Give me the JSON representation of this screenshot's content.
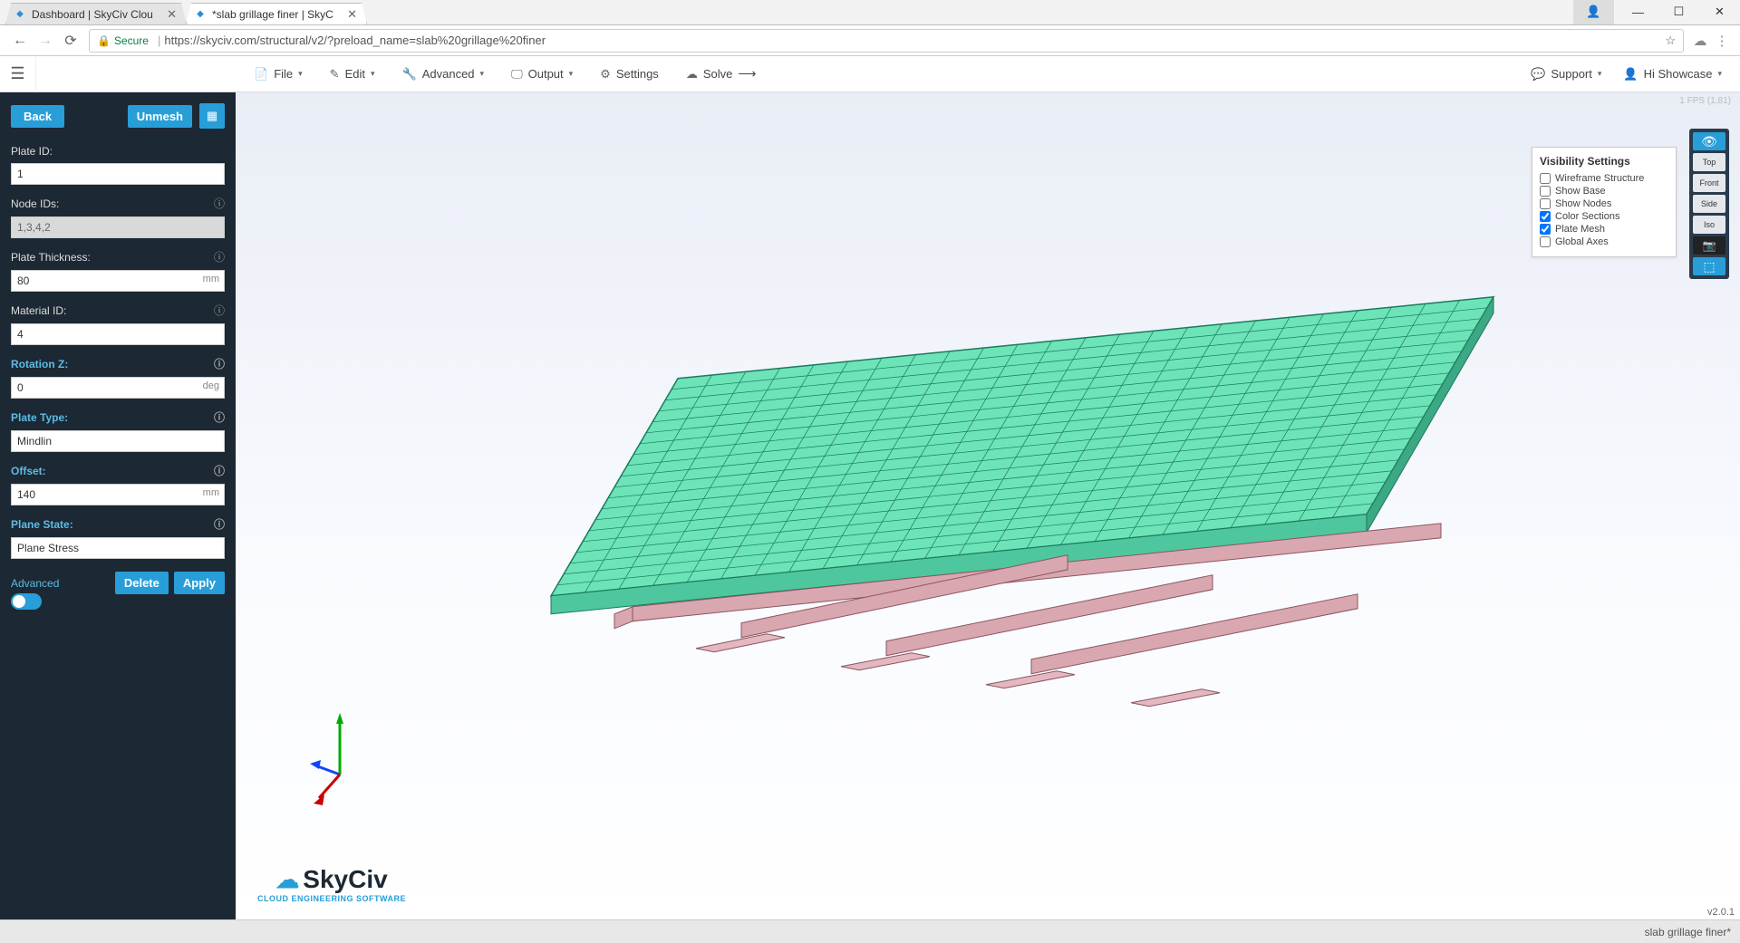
{
  "browser": {
    "tabs": [
      {
        "title": "Dashboard | SkyCiv Clou"
      },
      {
        "title": "*slab grillage finer | SkyC"
      }
    ],
    "secure": "Secure",
    "url": "https://skyciv.com/structural/v2/?preload_name=slab%20grillage%20finer"
  },
  "appmenu": {
    "file": "File",
    "edit": "Edit",
    "advanced": "Advanced",
    "output": "Output",
    "settings": "Settings",
    "solve": "Solve",
    "support": "Support",
    "user": "Hi Showcase"
  },
  "sidebar": {
    "back": "Back",
    "unmesh": "Unmesh",
    "plate_id_label": "Plate ID:",
    "plate_id": "1",
    "node_ids_label": "Node IDs:",
    "node_ids": "1,3,4,2",
    "thickness_label": "Plate Thickness:",
    "thickness": "80",
    "thickness_unit": "mm",
    "material_label": "Material ID:",
    "material": "4",
    "rotation_label": "Rotation Z:",
    "rotation": "0",
    "rotation_unit": "deg",
    "plate_type_label": "Plate Type:",
    "plate_type": "Mindlin",
    "offset_label": "Offset:",
    "offset": "140",
    "offset_unit": "mm",
    "plane_state_label": "Plane State:",
    "plane_state": "Plane Stress",
    "advanced": "Advanced",
    "delete": "Delete",
    "apply": "Apply"
  },
  "visibility": {
    "title": "Visibility Settings",
    "items": [
      {
        "label": "Wireframe Structure",
        "checked": false
      },
      {
        "label": "Show Base",
        "checked": false
      },
      {
        "label": "Show Nodes",
        "checked": false
      },
      {
        "label": "Color Sections",
        "checked": true
      },
      {
        "label": "Plate Mesh",
        "checked": true
      },
      {
        "label": "Global Axes",
        "checked": false
      }
    ]
  },
  "viewbtns": {
    "top": "Top",
    "front": "Front",
    "side": "Side",
    "iso": "Iso"
  },
  "canvas": {
    "fps": "1 FPS (1,81)",
    "version": "v2.0.1"
  },
  "logo": {
    "brand": "SkyCiv",
    "tag": "CLOUD ENGINEERING SOFTWARE"
  },
  "footer": {
    "filename": "slab grillage finer*"
  }
}
